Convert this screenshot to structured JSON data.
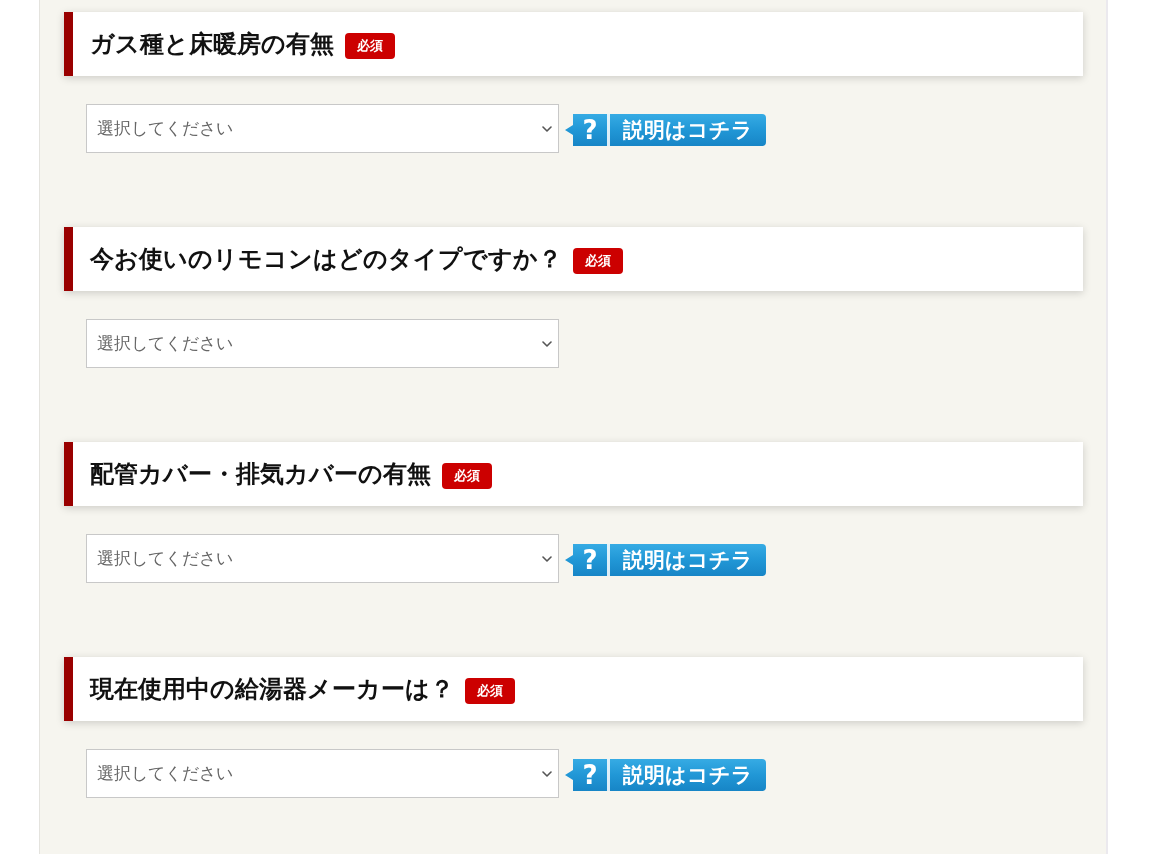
{
  "sections": [
    {
      "title": "ガス種と床暖房の有無",
      "badge": "必須",
      "select": {
        "placeholder": "選択してください"
      },
      "help_button": {
        "icon_text": "?",
        "label": "説明はコチラ"
      }
    },
    {
      "title": "今お使いのリモコンはどのタイプですか？",
      "badge": "必須",
      "select": {
        "placeholder": "選択してください"
      }
    },
    {
      "title": "配管カバー・排気カバーの有無",
      "badge": "必須",
      "select": {
        "placeholder": "選択してください"
      },
      "help_button": {
        "icon_text": "?",
        "label": "説明はコチラ"
      }
    },
    {
      "title": "現在使用中の給湯器メーカーは？",
      "badge": "必須",
      "select": {
        "placeholder": "選択してください"
      },
      "help_button": {
        "icon_text": "?",
        "label": "説明はコチラ"
      }
    }
  ]
}
